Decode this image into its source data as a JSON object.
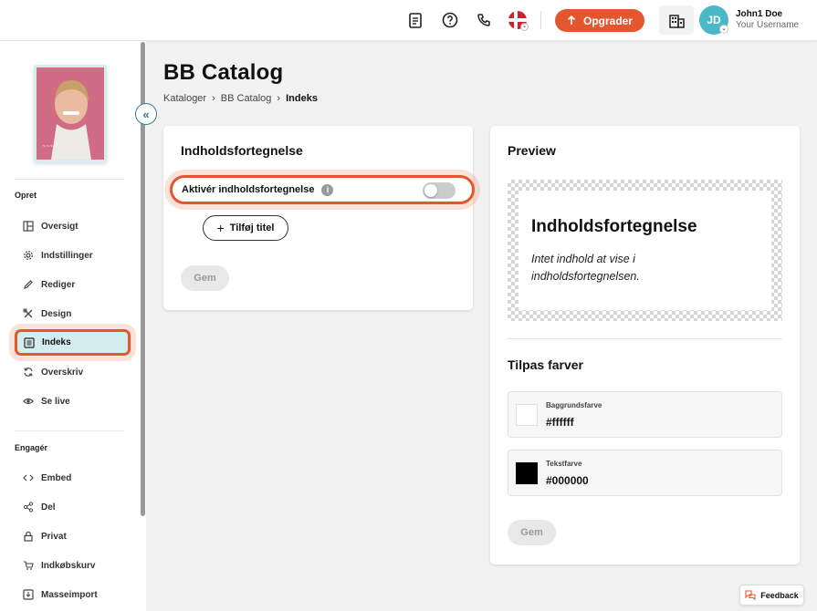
{
  "header": {
    "upgrade_label": "Opgrader",
    "user_name": "John1 Doe",
    "user_sub": "Your Username",
    "avatar_initials": "JD"
  },
  "sidebar": {
    "section_opret": "Opret",
    "section_engager": "Engagér",
    "items_opret": [
      {
        "label": "Oversigt",
        "icon": "layout-icon"
      },
      {
        "label": "Indstillinger",
        "icon": "gear-icon"
      },
      {
        "label": "Rediger",
        "icon": "pencil-icon"
      },
      {
        "label": "Design",
        "icon": "design-tools-icon"
      },
      {
        "label": "Indeks",
        "icon": "index-list-icon",
        "active": true
      },
      {
        "label": "Overskriv",
        "icon": "refresh-icon"
      },
      {
        "label": "Se live",
        "icon": "eye-icon"
      }
    ],
    "items_engager": [
      {
        "label": "Embed",
        "icon": "code-icon"
      },
      {
        "label": "Del",
        "icon": "share-icon"
      },
      {
        "label": "Privat",
        "icon": "lock-icon"
      },
      {
        "label": "Indkøbskurv",
        "icon": "cart-icon"
      },
      {
        "label": "Masseimport",
        "icon": "import-icon"
      }
    ]
  },
  "page": {
    "title": "BB Catalog",
    "breadcrumb": [
      "Kataloger",
      "BB Catalog",
      "Indeks"
    ]
  },
  "toc_card": {
    "title": "Indholdsfortegnelse",
    "toggle_label": "Aktivér indholdsfortegnelse",
    "toggle_on": false,
    "add_title_label": "Tilføj titel",
    "save_label": "Gem"
  },
  "preview_card": {
    "title": "Preview",
    "preview_heading": "Indholdsfortegnelse",
    "preview_text": "Intet indhold at vise i indholdsfortegnelsen.",
    "colors_title": "Tilpas farver",
    "bg_label": "Baggrundsfarve",
    "bg_value": "#ffffff",
    "text_label": "Tekstfarve",
    "text_value": "#000000",
    "save_label": "Gem"
  },
  "feedback_label": "Feedback",
  "colors": {
    "accent": "#e4572e",
    "teal": "#4ab8c7",
    "active_bg": "#d4edf0"
  }
}
